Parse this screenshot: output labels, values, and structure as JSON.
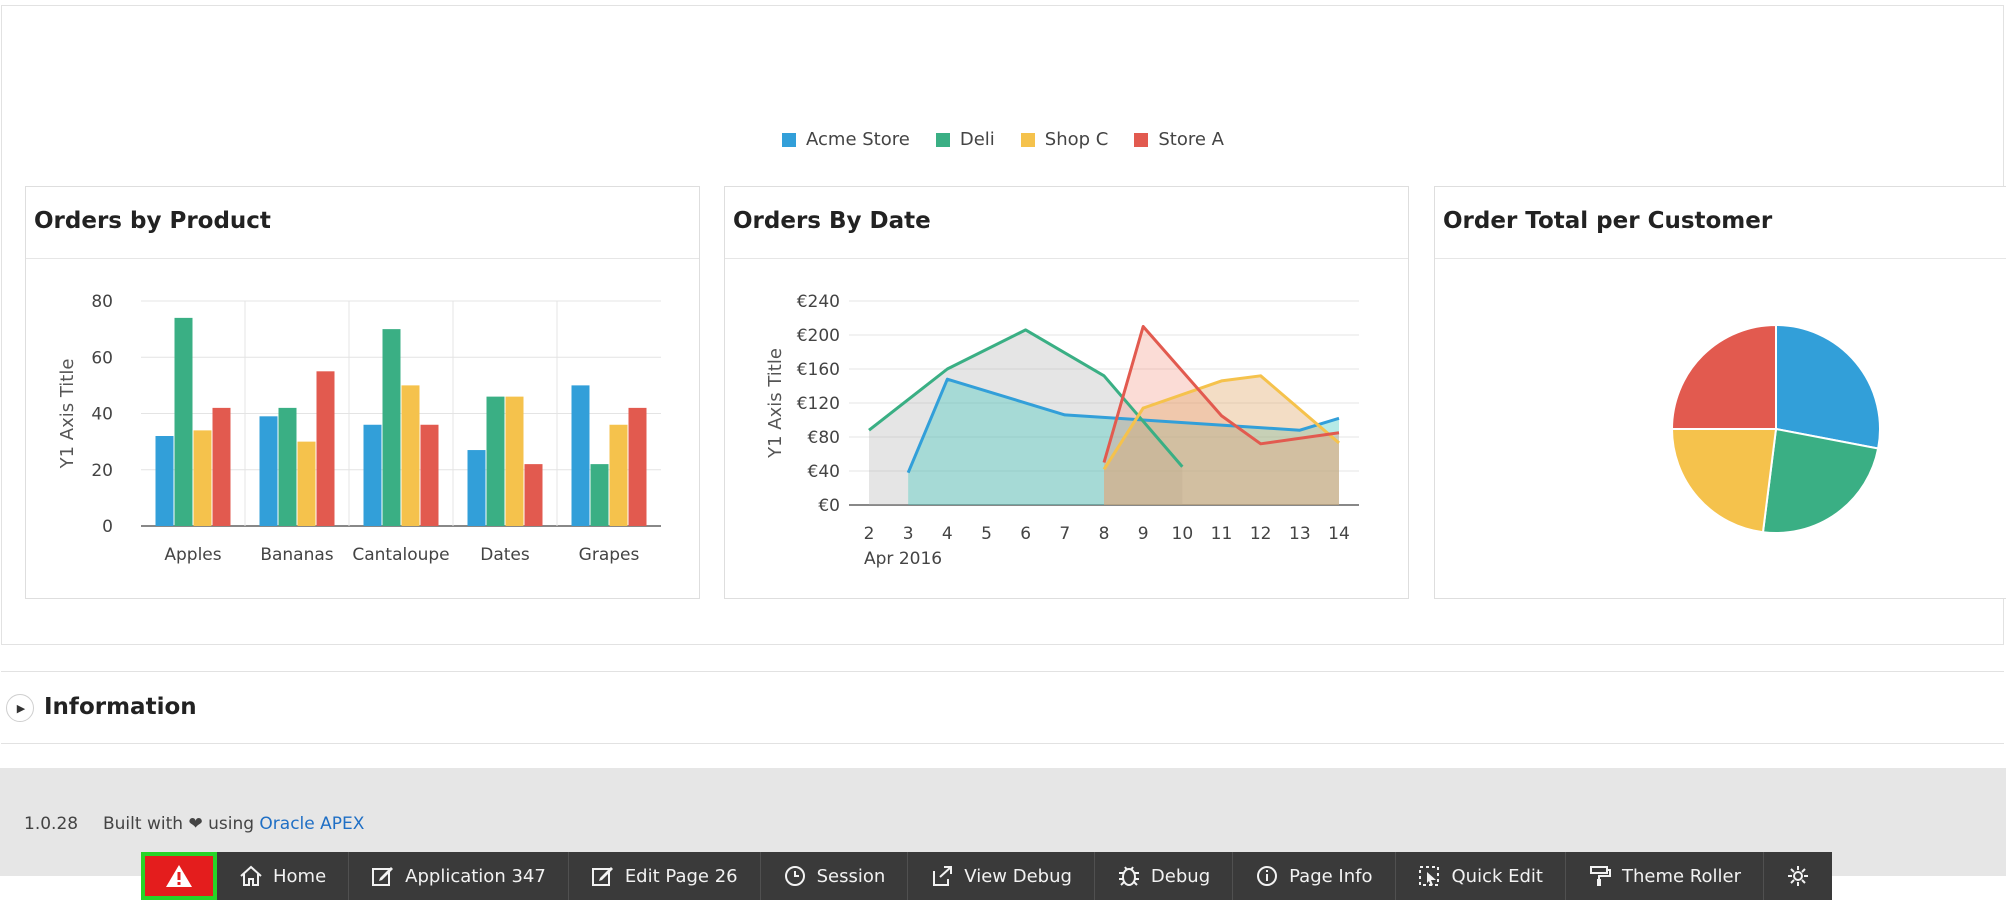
{
  "legend": [
    {
      "name": "Acme Store",
      "color": "#329fd9"
    },
    {
      "name": "Deli",
      "color": "#3aaf84"
    },
    {
      "name": "Shop C",
      "color": "#f5c24c"
    },
    {
      "name": "Store A",
      "color": "#e25a4f"
    }
  ],
  "cards": {
    "product_title": "Orders by Product",
    "date_title": "Orders By Date",
    "customer_title": "Order Total per Customer"
  },
  "chart_data": [
    {
      "type": "bar",
      "title": "Orders by Product",
      "xlabel": "",
      "ylabel": "Y1 Axis Title",
      "ylim": [
        0,
        80
      ],
      "yticks": [
        "0",
        "20",
        "40",
        "60",
        "80"
      ],
      "categories": [
        "Apples",
        "Bananas",
        "Cantaloupe",
        "Dates",
        "Grapes"
      ],
      "series": [
        {
          "name": "Acme Store",
          "values": [
            32,
            39,
            36,
            27,
            50
          ]
        },
        {
          "name": "Deli",
          "values": [
            74,
            42,
            70,
            46,
            22
          ]
        },
        {
          "name": "Shop C",
          "values": [
            34,
            30,
            50,
            46,
            36
          ]
        },
        {
          "name": "Store A",
          "values": [
            42,
            55,
            36,
            22,
            42
          ]
        }
      ],
      "grid": true
    },
    {
      "type": "area",
      "title": "Orders By Date",
      "ylabel": "Y1 Axis Title",
      "ylim": [
        0,
        240
      ],
      "yticks": [
        "€0",
        "€40",
        "€80",
        "€120",
        "€160",
        "€200",
        "€240"
      ],
      "xticks": [
        "2",
        "3",
        "4",
        "5",
        "6",
        "7",
        "8",
        "9",
        "10",
        "11",
        "12",
        "13",
        "14"
      ],
      "xsublabel": "Apr 2016",
      "series": [
        {
          "name": "Acme Store",
          "points": [
            [
              3,
              38
            ],
            [
              4,
              148
            ],
            [
              7,
              106
            ],
            [
              13,
              88
            ],
            [
              14,
              102
            ]
          ]
        },
        {
          "name": "Deli",
          "points": [
            [
              2,
              88
            ],
            [
              4,
              160
            ],
            [
              6,
              206
            ],
            [
              8,
              152
            ],
            [
              10,
              45
            ]
          ]
        },
        {
          "name": "Shop C",
          "points": [
            [
              8,
              42
            ],
            [
              9,
              114
            ],
            [
              11,
              146
            ],
            [
              12,
              152
            ],
            [
              14,
              73
            ]
          ]
        },
        {
          "name": "Store A",
          "points": [
            [
              8,
              50
            ],
            [
              9,
              210
            ],
            [
              11,
              105
            ],
            [
              12,
              72
            ],
            [
              14,
              85
            ]
          ]
        }
      ],
      "grid": true
    },
    {
      "type": "pie",
      "title": "Order Total per Customer",
      "series": [
        {
          "name": "Acme Store",
          "value": 28
        },
        {
          "name": "Deli",
          "value": 24
        },
        {
          "name": "Shop C",
          "value": 23
        },
        {
          "name": "Store A",
          "value": 25
        }
      ]
    }
  ],
  "information": {
    "title": "Information"
  },
  "footer": {
    "version": "1.0.28",
    "built_prefix": "Built with",
    "built_using": "using",
    "link_text": "Oracle APEX"
  },
  "devbar": {
    "home": "Home",
    "application": "Application 347",
    "edit_page": "Edit Page 26",
    "session": "Session",
    "view_debug": "View Debug",
    "debug": "Debug",
    "page_info": "Page Info",
    "quick_edit": "Quick Edit",
    "theme_roller": "Theme Roller"
  }
}
